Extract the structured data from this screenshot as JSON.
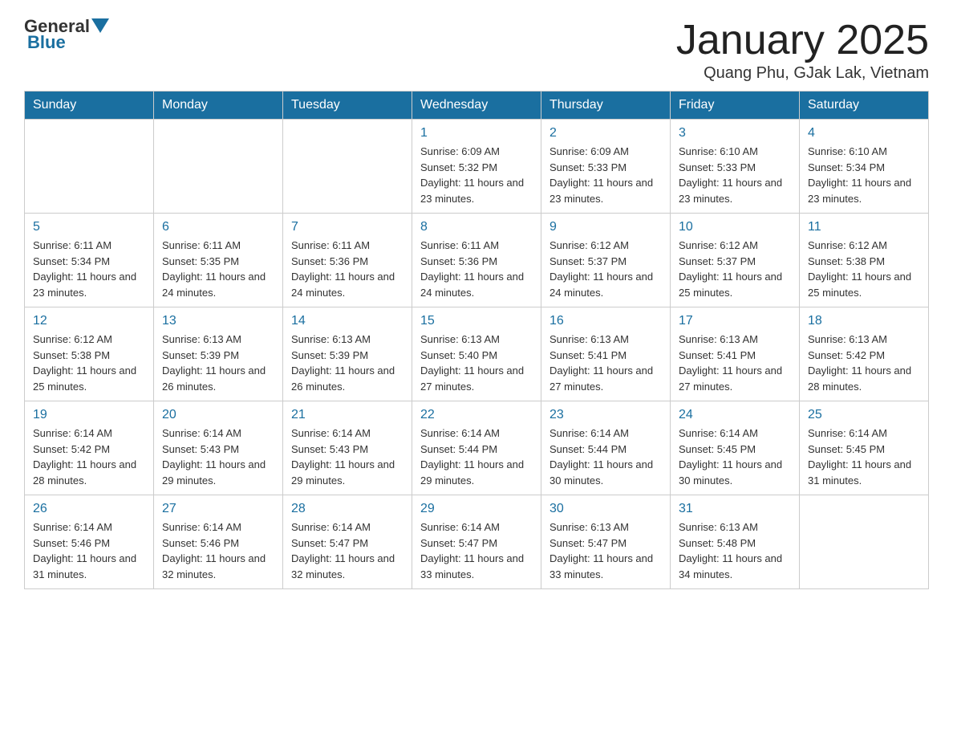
{
  "header": {
    "logo": {
      "text_general": "General",
      "text_blue": "Blue",
      "arrow": "▲"
    },
    "title": "January 2025",
    "location": "Quang Phu, GJak Lak, Vietnam"
  },
  "weekdays": [
    "Sunday",
    "Monday",
    "Tuesday",
    "Wednesday",
    "Thursday",
    "Friday",
    "Saturday"
  ],
  "weeks": [
    [
      {
        "day": "",
        "info": ""
      },
      {
        "day": "",
        "info": ""
      },
      {
        "day": "",
        "info": ""
      },
      {
        "day": "1",
        "info": "Sunrise: 6:09 AM\nSunset: 5:32 PM\nDaylight: 11 hours and 23 minutes."
      },
      {
        "day": "2",
        "info": "Sunrise: 6:09 AM\nSunset: 5:33 PM\nDaylight: 11 hours and 23 minutes."
      },
      {
        "day": "3",
        "info": "Sunrise: 6:10 AM\nSunset: 5:33 PM\nDaylight: 11 hours and 23 minutes."
      },
      {
        "day": "4",
        "info": "Sunrise: 6:10 AM\nSunset: 5:34 PM\nDaylight: 11 hours and 23 minutes."
      }
    ],
    [
      {
        "day": "5",
        "info": "Sunrise: 6:11 AM\nSunset: 5:34 PM\nDaylight: 11 hours and 23 minutes."
      },
      {
        "day": "6",
        "info": "Sunrise: 6:11 AM\nSunset: 5:35 PM\nDaylight: 11 hours and 24 minutes."
      },
      {
        "day": "7",
        "info": "Sunrise: 6:11 AM\nSunset: 5:36 PM\nDaylight: 11 hours and 24 minutes."
      },
      {
        "day": "8",
        "info": "Sunrise: 6:11 AM\nSunset: 5:36 PM\nDaylight: 11 hours and 24 minutes."
      },
      {
        "day": "9",
        "info": "Sunrise: 6:12 AM\nSunset: 5:37 PM\nDaylight: 11 hours and 24 minutes."
      },
      {
        "day": "10",
        "info": "Sunrise: 6:12 AM\nSunset: 5:37 PM\nDaylight: 11 hours and 25 minutes."
      },
      {
        "day": "11",
        "info": "Sunrise: 6:12 AM\nSunset: 5:38 PM\nDaylight: 11 hours and 25 minutes."
      }
    ],
    [
      {
        "day": "12",
        "info": "Sunrise: 6:12 AM\nSunset: 5:38 PM\nDaylight: 11 hours and 25 minutes."
      },
      {
        "day": "13",
        "info": "Sunrise: 6:13 AM\nSunset: 5:39 PM\nDaylight: 11 hours and 26 minutes."
      },
      {
        "day": "14",
        "info": "Sunrise: 6:13 AM\nSunset: 5:39 PM\nDaylight: 11 hours and 26 minutes."
      },
      {
        "day": "15",
        "info": "Sunrise: 6:13 AM\nSunset: 5:40 PM\nDaylight: 11 hours and 27 minutes."
      },
      {
        "day": "16",
        "info": "Sunrise: 6:13 AM\nSunset: 5:41 PM\nDaylight: 11 hours and 27 minutes."
      },
      {
        "day": "17",
        "info": "Sunrise: 6:13 AM\nSunset: 5:41 PM\nDaylight: 11 hours and 27 minutes."
      },
      {
        "day": "18",
        "info": "Sunrise: 6:13 AM\nSunset: 5:42 PM\nDaylight: 11 hours and 28 minutes."
      }
    ],
    [
      {
        "day": "19",
        "info": "Sunrise: 6:14 AM\nSunset: 5:42 PM\nDaylight: 11 hours and 28 minutes."
      },
      {
        "day": "20",
        "info": "Sunrise: 6:14 AM\nSunset: 5:43 PM\nDaylight: 11 hours and 29 minutes."
      },
      {
        "day": "21",
        "info": "Sunrise: 6:14 AM\nSunset: 5:43 PM\nDaylight: 11 hours and 29 minutes."
      },
      {
        "day": "22",
        "info": "Sunrise: 6:14 AM\nSunset: 5:44 PM\nDaylight: 11 hours and 29 minutes."
      },
      {
        "day": "23",
        "info": "Sunrise: 6:14 AM\nSunset: 5:44 PM\nDaylight: 11 hours and 30 minutes."
      },
      {
        "day": "24",
        "info": "Sunrise: 6:14 AM\nSunset: 5:45 PM\nDaylight: 11 hours and 30 minutes."
      },
      {
        "day": "25",
        "info": "Sunrise: 6:14 AM\nSunset: 5:45 PM\nDaylight: 11 hours and 31 minutes."
      }
    ],
    [
      {
        "day": "26",
        "info": "Sunrise: 6:14 AM\nSunset: 5:46 PM\nDaylight: 11 hours and 31 minutes."
      },
      {
        "day": "27",
        "info": "Sunrise: 6:14 AM\nSunset: 5:46 PM\nDaylight: 11 hours and 32 minutes."
      },
      {
        "day": "28",
        "info": "Sunrise: 6:14 AM\nSunset: 5:47 PM\nDaylight: 11 hours and 32 minutes."
      },
      {
        "day": "29",
        "info": "Sunrise: 6:14 AM\nSunset: 5:47 PM\nDaylight: 11 hours and 33 minutes."
      },
      {
        "day": "30",
        "info": "Sunrise: 6:13 AM\nSunset: 5:47 PM\nDaylight: 11 hours and 33 minutes."
      },
      {
        "day": "31",
        "info": "Sunrise: 6:13 AM\nSunset: 5:48 PM\nDaylight: 11 hours and 34 minutes."
      },
      {
        "day": "",
        "info": ""
      }
    ]
  ],
  "colors": {
    "header_bg": "#1a6fa0",
    "accent": "#1a6fa0"
  }
}
